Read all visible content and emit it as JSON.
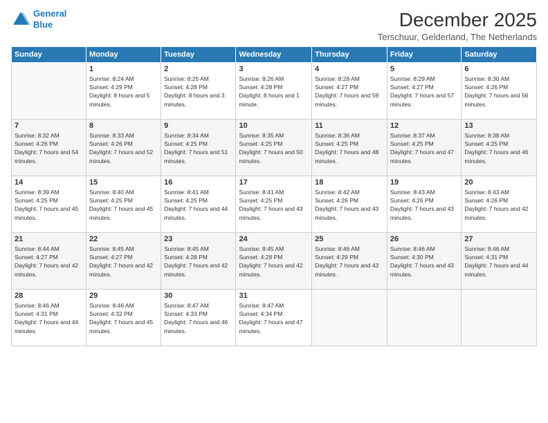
{
  "logo": {
    "line1": "General",
    "line2": "Blue"
  },
  "title": "December 2025",
  "subtitle": "Terschuur, Gelderland, The Netherlands",
  "headers": [
    "Sunday",
    "Monday",
    "Tuesday",
    "Wednesday",
    "Thursday",
    "Friday",
    "Saturday"
  ],
  "weeks": [
    [
      {
        "day": "",
        "sunrise": "",
        "sunset": "",
        "daylight": ""
      },
      {
        "day": "1",
        "sunrise": "Sunrise: 8:24 AM",
        "sunset": "Sunset: 4:29 PM",
        "daylight": "Daylight: 8 hours and 5 minutes."
      },
      {
        "day": "2",
        "sunrise": "Sunrise: 8:25 AM",
        "sunset": "Sunset: 4:28 PM",
        "daylight": "Daylight: 8 hours and 3 minutes."
      },
      {
        "day": "3",
        "sunrise": "Sunrise: 8:26 AM",
        "sunset": "Sunset: 4:28 PM",
        "daylight": "Daylight: 8 hours and 1 minute."
      },
      {
        "day": "4",
        "sunrise": "Sunrise: 8:28 AM",
        "sunset": "Sunset: 4:27 PM",
        "daylight": "Daylight: 7 hours and 59 minutes."
      },
      {
        "day": "5",
        "sunrise": "Sunrise: 8:29 AM",
        "sunset": "Sunset: 4:27 PM",
        "daylight": "Daylight: 7 hours and 57 minutes."
      },
      {
        "day": "6",
        "sunrise": "Sunrise: 8:30 AM",
        "sunset": "Sunset: 4:26 PM",
        "daylight": "Daylight: 7 hours and 56 minutes."
      }
    ],
    [
      {
        "day": "7",
        "sunrise": "Sunrise: 8:32 AM",
        "sunset": "Sunset: 4:26 PM",
        "daylight": "Daylight: 7 hours and 54 minutes."
      },
      {
        "day": "8",
        "sunrise": "Sunrise: 8:33 AM",
        "sunset": "Sunset: 4:26 PM",
        "daylight": "Daylight: 7 hours and 52 minutes."
      },
      {
        "day": "9",
        "sunrise": "Sunrise: 8:34 AM",
        "sunset": "Sunset: 4:25 PM",
        "daylight": "Daylight: 7 hours and 51 minutes."
      },
      {
        "day": "10",
        "sunrise": "Sunrise: 8:35 AM",
        "sunset": "Sunset: 4:25 PM",
        "daylight": "Daylight: 7 hours and 50 minutes."
      },
      {
        "day": "11",
        "sunrise": "Sunrise: 8:36 AM",
        "sunset": "Sunset: 4:25 PM",
        "daylight": "Daylight: 7 hours and 48 minutes."
      },
      {
        "day": "12",
        "sunrise": "Sunrise: 8:37 AM",
        "sunset": "Sunset: 4:25 PM",
        "daylight": "Daylight: 7 hours and 47 minutes."
      },
      {
        "day": "13",
        "sunrise": "Sunrise: 8:38 AM",
        "sunset": "Sunset: 4:25 PM",
        "daylight": "Daylight: 7 hours and 46 minutes."
      }
    ],
    [
      {
        "day": "14",
        "sunrise": "Sunrise: 8:39 AM",
        "sunset": "Sunset: 4:25 PM",
        "daylight": "Daylight: 7 hours and 45 minutes."
      },
      {
        "day": "15",
        "sunrise": "Sunrise: 8:40 AM",
        "sunset": "Sunset: 4:25 PM",
        "daylight": "Daylight: 7 hours and 45 minutes."
      },
      {
        "day": "16",
        "sunrise": "Sunrise: 8:41 AM",
        "sunset": "Sunset: 4:25 PM",
        "daylight": "Daylight: 7 hours and 44 minutes."
      },
      {
        "day": "17",
        "sunrise": "Sunrise: 8:41 AM",
        "sunset": "Sunset: 4:25 PM",
        "daylight": "Daylight: 7 hours and 43 minutes."
      },
      {
        "day": "18",
        "sunrise": "Sunrise: 8:42 AM",
        "sunset": "Sunset: 4:26 PM",
        "daylight": "Daylight: 7 hours and 43 minutes."
      },
      {
        "day": "19",
        "sunrise": "Sunrise: 8:43 AM",
        "sunset": "Sunset: 4:26 PM",
        "daylight": "Daylight: 7 hours and 43 minutes."
      },
      {
        "day": "20",
        "sunrise": "Sunrise: 8:43 AM",
        "sunset": "Sunset: 4:26 PM",
        "daylight": "Daylight: 7 hours and 42 minutes."
      }
    ],
    [
      {
        "day": "21",
        "sunrise": "Sunrise: 8:44 AM",
        "sunset": "Sunset: 4:27 PM",
        "daylight": "Daylight: 7 hours and 42 minutes."
      },
      {
        "day": "22",
        "sunrise": "Sunrise: 8:45 AM",
        "sunset": "Sunset: 4:27 PM",
        "daylight": "Daylight: 7 hours and 42 minutes."
      },
      {
        "day": "23",
        "sunrise": "Sunrise: 8:45 AM",
        "sunset": "Sunset: 4:28 PM",
        "daylight": "Daylight: 7 hours and 42 minutes."
      },
      {
        "day": "24",
        "sunrise": "Sunrise: 8:45 AM",
        "sunset": "Sunset: 4:28 PM",
        "daylight": "Daylight: 7 hours and 42 minutes."
      },
      {
        "day": "25",
        "sunrise": "Sunrise: 8:46 AM",
        "sunset": "Sunset: 4:29 PM",
        "daylight": "Daylight: 7 hours and 43 minutes."
      },
      {
        "day": "26",
        "sunrise": "Sunrise: 8:46 AM",
        "sunset": "Sunset: 4:30 PM",
        "daylight": "Daylight: 7 hours and 43 minutes."
      },
      {
        "day": "27",
        "sunrise": "Sunrise: 8:46 AM",
        "sunset": "Sunset: 4:31 PM",
        "daylight": "Daylight: 7 hours and 44 minutes."
      }
    ],
    [
      {
        "day": "28",
        "sunrise": "Sunrise: 8:46 AM",
        "sunset": "Sunset: 4:31 PM",
        "daylight": "Daylight: 7 hours and 44 minutes."
      },
      {
        "day": "29",
        "sunrise": "Sunrise: 8:46 AM",
        "sunset": "Sunset: 4:32 PM",
        "daylight": "Daylight: 7 hours and 45 minutes."
      },
      {
        "day": "30",
        "sunrise": "Sunrise: 8:47 AM",
        "sunset": "Sunset: 4:33 PM",
        "daylight": "Daylight: 7 hours and 46 minutes."
      },
      {
        "day": "31",
        "sunrise": "Sunrise: 8:47 AM",
        "sunset": "Sunset: 4:34 PM",
        "daylight": "Daylight: 7 hours and 47 minutes."
      },
      {
        "day": "",
        "sunrise": "",
        "sunset": "",
        "daylight": ""
      },
      {
        "day": "",
        "sunrise": "",
        "sunset": "",
        "daylight": ""
      },
      {
        "day": "",
        "sunrise": "",
        "sunset": "",
        "daylight": ""
      }
    ]
  ]
}
